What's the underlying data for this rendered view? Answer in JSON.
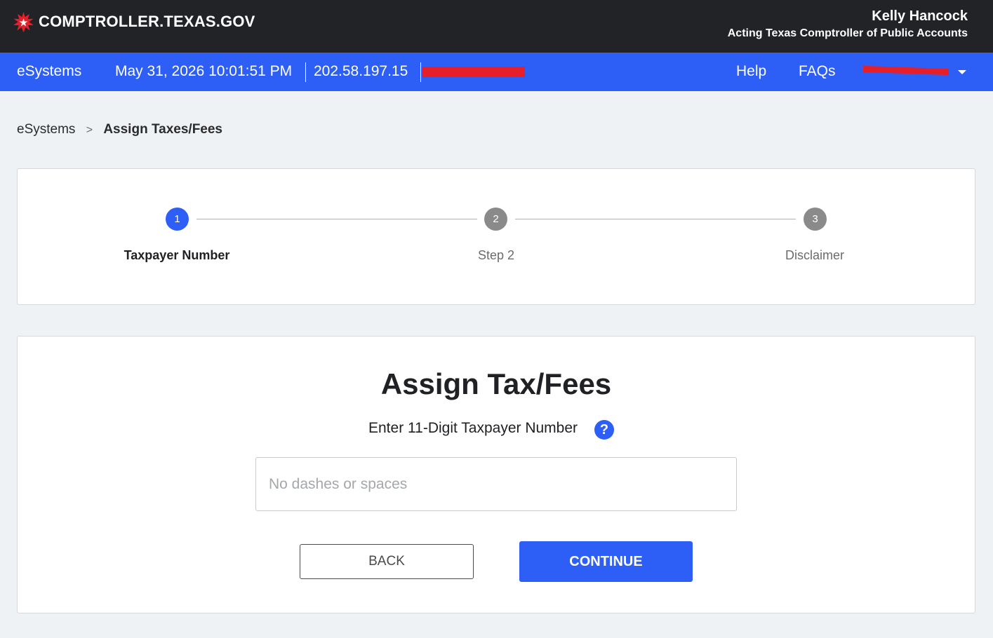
{
  "header": {
    "site_name": "COMPTROLLER.TEXAS.GOV",
    "official_name": "Kelly Hancock",
    "official_title": "Acting Texas Comptroller of Public Accounts"
  },
  "nav": {
    "brand": "eSystems",
    "datetime": "May 31, 2026 10:01:51 PM",
    "ip": "202.58.197.15",
    "help": "Help",
    "faqs": "FAQs"
  },
  "breadcrumb": {
    "root": "eSystems",
    "separator": ">",
    "current": "Assign Taxes/Fees"
  },
  "stepper": {
    "steps": [
      {
        "number": "1",
        "label": "Taxpayer Number",
        "state": "active"
      },
      {
        "number": "2",
        "label": "Step 2",
        "state": "inactive"
      },
      {
        "number": "3",
        "label": "Disclaimer",
        "state": "inactive"
      }
    ]
  },
  "form": {
    "title": "Assign Tax/Fees",
    "label": "Enter 11-Digit Taxpayer Number",
    "help_glyph": "?",
    "input_placeholder": "No dashes or spaces",
    "input_value": "",
    "back_label": "BACK",
    "continue_label": "CONTINUE"
  },
  "colors": {
    "header_bg": "#212327",
    "nav_bg": "#2d5ff7",
    "accent": "#2d5ff7",
    "redaction": "#e5202a",
    "page_bg": "#eff2f5"
  },
  "icons": [
    "star-seal-icon",
    "chevron-down-icon",
    "question-icon"
  ]
}
